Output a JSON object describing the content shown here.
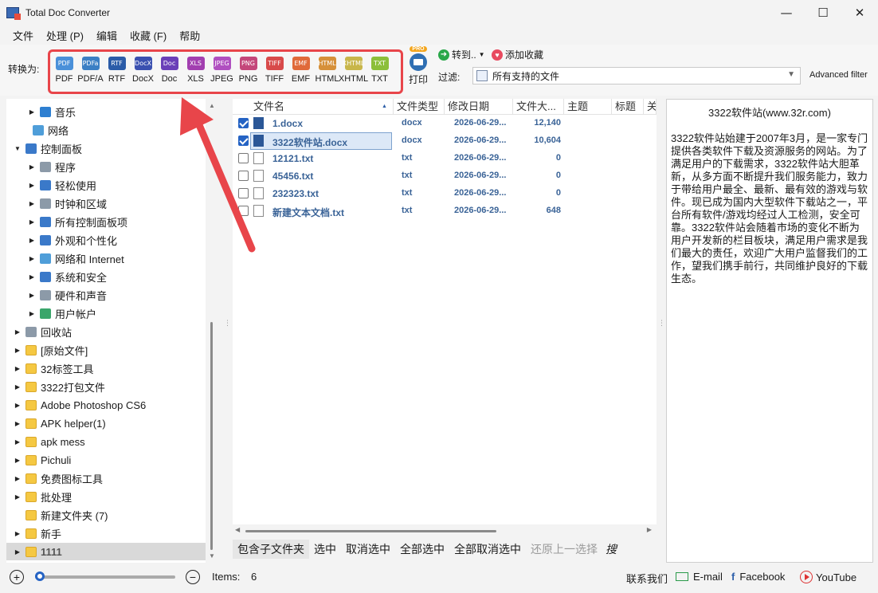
{
  "window": {
    "title": "Total Doc Converter",
    "controls": {
      "minimize": "—",
      "maximize": "☐",
      "close": "✕"
    }
  },
  "menu": [
    "文件",
    "处理 (P)",
    "编辑",
    "收藏 (F)",
    "帮助"
  ],
  "toolbar": {
    "convert_label": "转换为:",
    "formats": [
      {
        "icon_text": "PDF",
        "label": "PDF",
        "color": "#4a90d9"
      },
      {
        "icon_text": "PDFa",
        "label": "PDF/A",
        "color": "#3b7fc4"
      },
      {
        "icon_text": "RTF",
        "label": "RTF",
        "color": "#2b5ca8"
      },
      {
        "icon_text": "DocX",
        "label": "DocX",
        "color": "#3a50b0"
      },
      {
        "icon_text": "Doc",
        "label": "Doc",
        "color": "#6a3fb8"
      },
      {
        "icon_text": "XLS",
        "label": "XLS",
        "color": "#a23fb0"
      },
      {
        "icon_text": "JPEG",
        "label": "JPEG",
        "color": "#b04fc0"
      },
      {
        "icon_text": "PNG",
        "label": "PNG",
        "color": "#c4477a"
      },
      {
        "icon_text": "TIFF",
        "label": "TIFF",
        "color": "#d84a4a"
      },
      {
        "icon_text": "EMF",
        "label": "EMF",
        "color": "#e06a3a"
      },
      {
        "icon_text": "HTML",
        "label": "HTML",
        "color": "#d6903a"
      },
      {
        "icon_text": "XHTML",
        "label": "XHTML",
        "color": "#c8b64a"
      },
      {
        "icon_text": "TXT",
        "label": "TXT",
        "color": "#8cbf3a"
      }
    ],
    "print_badge": "PRO",
    "print_label": "打印",
    "goto_label": "转到..",
    "favorite_label": "添加收藏",
    "filter_label": "过滤:",
    "filter_value": "所有支持的文件",
    "advanced_filter": "Advanced filter"
  },
  "tree": {
    "items": [
      {
        "label": "音乐",
        "level": 2,
        "caret": "▶",
        "icon": "music-icon",
        "color": "#2e7fd1"
      },
      {
        "label": "网络",
        "level": 1,
        "caret": "",
        "icon": "network-icon",
        "color": "#4f9ed9"
      },
      {
        "label": "控制面板",
        "level": 0,
        "caret": "▼",
        "icon": "control-panel-icon",
        "color": "#3a79c9"
      },
      {
        "label": "程序",
        "level": 2,
        "caret": "▶",
        "icon": "programs-icon",
        "color": "#8c9aa8"
      },
      {
        "label": "轻松使用",
        "level": 2,
        "caret": "▶",
        "icon": "ease-of-access-icon",
        "color": "#3a79c9"
      },
      {
        "label": "时钟和区域",
        "level": 2,
        "caret": "▶",
        "icon": "clock-icon",
        "color": "#8c9aa8"
      },
      {
        "label": "所有控制面板项",
        "level": 2,
        "caret": "▶",
        "icon": "control-panel-icon",
        "color": "#3a79c9"
      },
      {
        "label": "外观和个性化",
        "level": 2,
        "caret": "▶",
        "icon": "appearance-icon",
        "color": "#3a79c9"
      },
      {
        "label": "网络和 Internet",
        "level": 2,
        "caret": "▶",
        "icon": "network-icon",
        "color": "#4f9ed9"
      },
      {
        "label": "系统和安全",
        "level": 2,
        "caret": "▶",
        "icon": "shield-icon",
        "color": "#3a79c9"
      },
      {
        "label": "硬件和声音",
        "level": 2,
        "caret": "▶",
        "icon": "printer-icon",
        "color": "#8c9aa8"
      },
      {
        "label": "用户帐户",
        "level": 2,
        "caret": "▶",
        "icon": "users-icon",
        "color": "#3aa66b"
      },
      {
        "label": "回收站",
        "level": 0,
        "caret": "▶",
        "icon": "recycle-bin-icon",
        "color": "#8c9aa8"
      },
      {
        "label": "[原始文件]",
        "level": 0,
        "caret": "▶",
        "icon": "folder-icon",
        "color": "#f5c842"
      },
      {
        "label": "32标签工具",
        "level": 0,
        "caret": "▶",
        "icon": "folder-icon",
        "color": "#f5c842"
      },
      {
        "label": "3322打包文件",
        "level": 0,
        "caret": "▶",
        "icon": "folder-icon",
        "color": "#f5c842"
      },
      {
        "label": "Adobe Photoshop CS6",
        "level": 0,
        "caret": "▶",
        "icon": "folder-icon",
        "color": "#f5c842"
      },
      {
        "label": "APK helper(1)",
        "level": 0,
        "caret": "▶",
        "icon": "folder-icon",
        "color": "#f5c842"
      },
      {
        "label": "apk mess",
        "level": 0,
        "caret": "▶",
        "icon": "folder-icon",
        "color": "#f5c842"
      },
      {
        "label": "Pichuli",
        "level": 0,
        "caret": "▶",
        "icon": "folder-icon",
        "color": "#f5c842"
      },
      {
        "label": "免费图标工具",
        "level": 0,
        "caret": "▶",
        "icon": "folder-icon",
        "color": "#f5c842"
      },
      {
        "label": "批处理",
        "level": 0,
        "caret": "▶",
        "icon": "folder-icon",
        "color": "#f5c842"
      },
      {
        "label": "新建文件夹 (7)",
        "level": 0,
        "caret": "",
        "icon": "folder-icon",
        "color": "#f5c842"
      },
      {
        "label": "新手",
        "level": 0,
        "caret": "▶",
        "icon": "folder-icon",
        "color": "#f5c842"
      },
      {
        "label": "1111",
        "level": 0,
        "caret": "▶",
        "icon": "folder-icon",
        "color": "#f5c842",
        "selected": true
      }
    ]
  },
  "filelist": {
    "columns": [
      "文件名",
      "文件类型",
      "修改日期",
      "文件大...",
      "主题",
      "标题",
      "关"
    ],
    "rows": [
      {
        "name": "1.docx",
        "type": "docx",
        "date": "2026-06-29...",
        "size": "12,140",
        "checked": true,
        "icon": "word-icon"
      },
      {
        "name": "3322软件站.docx",
        "type": "docx",
        "date": "2026-06-29...",
        "size": "10,604",
        "checked": true,
        "icon": "word-icon",
        "selected": true
      },
      {
        "name": "12121.txt",
        "type": "txt",
        "date": "2026-06-29...",
        "size": "0",
        "checked": false,
        "icon": "text-file-icon"
      },
      {
        "name": "45456.txt",
        "type": "txt",
        "date": "2026-06-29...",
        "size": "0",
        "checked": false,
        "icon": "text-file-icon"
      },
      {
        "name": "232323.txt",
        "type": "txt",
        "date": "2026-06-29...",
        "size": "0",
        "checked": false,
        "icon": "text-file-icon"
      },
      {
        "name": "新建文本文档.txt",
        "type": "txt",
        "date": "2026-06-29...",
        "size": "648",
        "checked": false,
        "icon": "text-file-icon"
      }
    ]
  },
  "actions": {
    "include_subfolders": "包含子文件夹",
    "select": "选中",
    "deselect": "取消选中",
    "select_all": "全部选中",
    "deselect_all": "全部取消选中",
    "restore_previous": "还原上一选择",
    "search": "搜"
  },
  "preview": {
    "title": "3322软件站(www.32r.com)",
    "body": "3322软件站始建于2007年3月，是一家专门提供各类软件下载及资源服务的网站。为了满足用户的下载需求，3322软件站大胆革新，从多方面不断提升我们服务能力，致力于带给用户最全、最新、最有效的游戏与软件。现已成为国内大型软件下载站之一，平台所有软件/游戏均经过人工检测，安全可靠。3322软件站会随着市场的变化不断为用户开发新的栏目板块，满足用户需求是我们最大的责任，欢迎广大用户监督我们的工作，望我们携手前行，共同维护良好的下载生态。"
  },
  "status": {
    "zoom_in": "+",
    "zoom_out": "−",
    "zoom_level": 0,
    "items_label": "Items:",
    "items_count": "6",
    "contact": "联系我们",
    "email": "E-mail",
    "facebook": "Facebook",
    "youtube": "YouTube"
  },
  "colors": {
    "accent": "#2563c4",
    "highlight_box": "#e8454a",
    "file_text": "#3a6397"
  }
}
